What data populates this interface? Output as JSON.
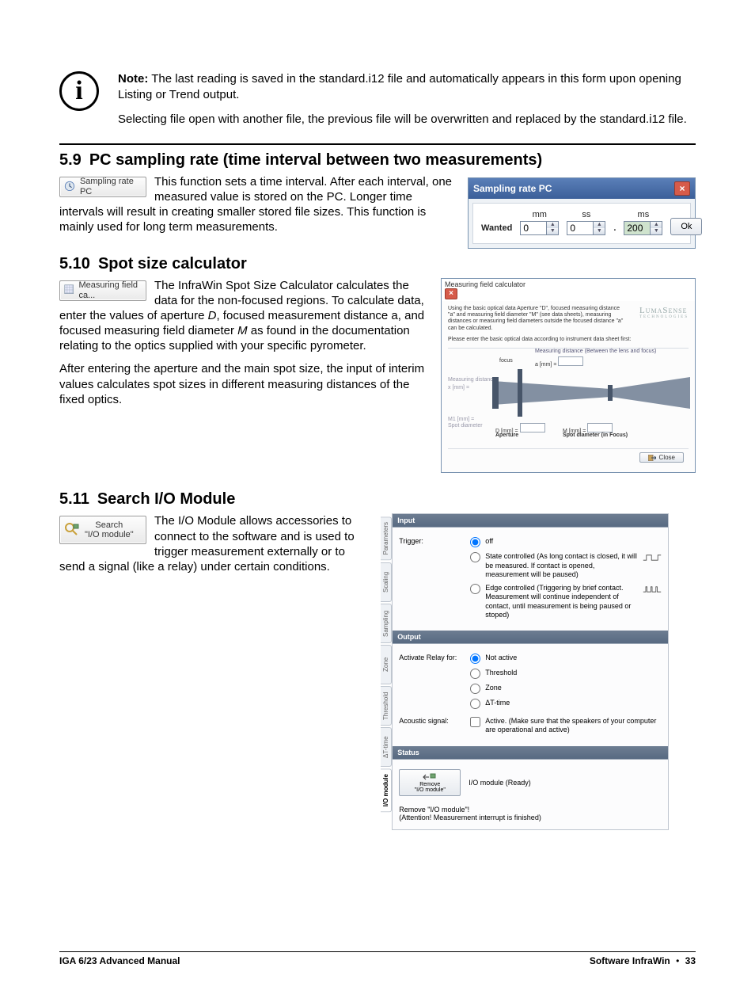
{
  "note": {
    "lead": "Note:",
    "p1_rest": "  The last reading is saved in the standard.i12 file and automatically appears in this form upon opening Listing or Trend output.",
    "p2": "Selecting file open with another file, the previous file will be overwritten and replaced by the standard.i12 file."
  },
  "s59": {
    "num": "5.9",
    "title": "PC sampling rate (time interval between two measurements)",
    "btn": "Sampling rate PC",
    "p": "This function sets a time interval. After each interval, one measured value is stored on the PC. Longer time intervals will result in creating smaller stored file sizes. This function is mainly used for long term measurements.",
    "dlg": {
      "title": "Sampling rate PC",
      "wanted": "Wanted",
      "mm": "mm",
      "ss": "ss",
      "ms": "ms",
      "v_mm": "0",
      "v_ss": "0",
      "v_ms": "200",
      "ok": "Ok"
    }
  },
  "s510": {
    "num": "5.10",
    "title": "Spot size calculator",
    "btn": "Measuring field ca...",
    "p1": "The InfraWin Spot Size Calculator calculates the data for the non-focused regions. To calculate data, enter the values of aperture D, focused measurement distance a, and focused measuring field diameter M as found in the documentation relating to the optics supplied with your specific pyrometer.",
    "p2": "After entering the aperture and the main spot size, the input of interim values calculates spot sizes in different measuring distances of the fixed optics.",
    "dlg": {
      "title": "Measuring field calculator",
      "brand": "LUMASENSE",
      "brand_sub": "TECHNOLOGIES",
      "instr": "Using the basic optical data Aperture \"D\", focused measuring distance \"a\" and measuring field diameter \"M\" (see data sheets), measuring distances or measuring field diameters outside the focused distance \"a\" can be calculated.",
      "instr2": "Please enter the basic optical data according to instrument data sheet first:",
      "meas_dist_hdr": "Measuring distance (Between the lens and focus)",
      "focus": "focus",
      "a_mm": "a [mm] =",
      "meas_dist": "Measuring distance",
      "x_mm": "x [mm] =",
      "M1_mm": "M1 [mm] =",
      "spot_diam": "Spot diameter",
      "D_mm": "D [mm] =",
      "aperture": "Aperture",
      "M_mm": "M [mm] =",
      "spot_focus": "Spot diameter (in Focus)",
      "close": "Close"
    }
  },
  "s511": {
    "num": "5.11",
    "title": "Search I/O Module",
    "btn_l1": "Search",
    "btn_l2": "\"I/O module\"",
    "p": "The I/O Module allows accessories to connect to the software and is used to trigger measurement externally or to send a signal (like a relay) under certain conditions.",
    "tabs": [
      "Parameters",
      "Scaling",
      "Sampling",
      "Zone",
      "Threshold",
      "ΔT-time",
      "I/O module"
    ],
    "input": {
      "hdr": "Input",
      "trigger_lbl": "Trigger:",
      "off": "off",
      "state": "State controlled (As long contact is closed, it will be measured. If contact is opened, measurement will be paused)",
      "edge": "Edge controlled (Triggering by brief contact. Measurement will continue independent of contact, until measurement is being paused or stoped)"
    },
    "output": {
      "hdr": "Output",
      "relay_lbl": "Activate Relay for:",
      "not_active": "Not active",
      "threshold": "Threshold",
      "zone": "Zone",
      "dttime": "ΔT-time",
      "acoustic_lbl": "Acoustic signal:",
      "acoustic_txt": "Active. (Make sure that the speakers of your computer are operational and active)"
    },
    "status": {
      "hdr": "Status",
      "remove_l1": "Remove",
      "remove_l2": "\"I/O module\"",
      "ready": "I/O module (Ready)",
      "warn": "Remove  \"I/O module\"!\n(Attention! Measurement interrupt is finished)"
    }
  },
  "footer": {
    "left": "IGA 6/23 Advanced Manual",
    "right_a": "Software InfraWin",
    "right_b": "33",
    "bullet": "•"
  }
}
